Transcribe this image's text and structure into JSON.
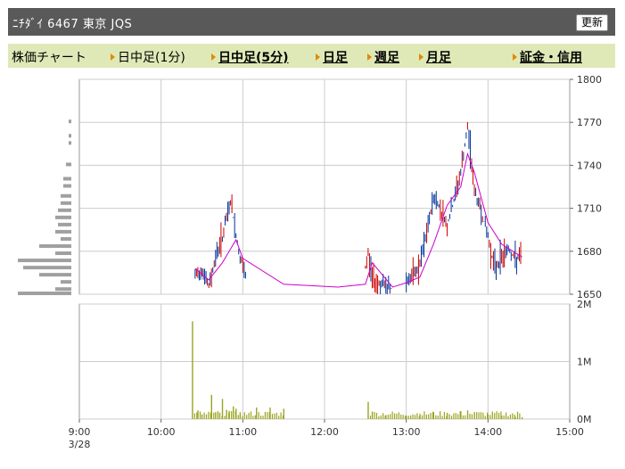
{
  "header": {
    "title": "ﾆﾁﾀﾞｲ  6467  東京 JQS",
    "refresh_label": "更新"
  },
  "tabs": [
    {
      "label": "株価チャート",
      "link": false,
      "marker": false
    },
    {
      "label": "日中足(1分)",
      "link": false,
      "marker": true
    },
    {
      "label": "日中足(5分)",
      "link": true,
      "marker": true
    },
    {
      "label": "日足",
      "link": true,
      "marker": true
    },
    {
      "label": "週足",
      "link": true,
      "marker": true
    },
    {
      "label": "月足",
      "link": true,
      "marker": true
    },
    {
      "label": "証金・信用",
      "link": true,
      "marker": true
    }
  ],
  "colors": {
    "candle_up": "#cc0000",
    "candle_down": "#003399",
    "moving_average": "#cc00cc",
    "volume": "#9aa520",
    "volume_profile": "#a0a0a0",
    "grid": "#cccccc"
  },
  "chart_data": [
    {
      "type": "line",
      "yticks": [
        "1800",
        "1770",
        "1740",
        "1710",
        "1680",
        "1650"
      ],
      "ylim": [
        1650,
        1800
      ],
      "xticks": [
        "9:00",
        "10:00",
        "11:00",
        "12:00",
        "13:00",
        "14:00",
        "15:00"
      ],
      "x_sub_label": "3/28",
      "xlim": [
        "9:00",
        "15:00"
      ],
      "grid": true,
      "series": [
        {
          "x": [
            "10:25",
            "10:35",
            "10:45",
            "10:55",
            "11:00",
            "11:30",
            "12:10",
            "12:30",
            "12:35",
            "12:50",
            "13:00",
            "13:10",
            "13:20",
            "13:30",
            "13:40",
            "13:45",
            "13:50",
            "14:00",
            "14:10",
            "14:20",
            "14:25"
          ],
          "values": [
            1668,
            1660,
            1672,
            1688,
            1675,
            1657,
            1655,
            1657,
            1672,
            1655,
            1658,
            1662,
            1685,
            1712,
            1725,
            1748,
            1735,
            1700,
            1685,
            1679,
            1676
          ]
        }
      ],
      "price_segments": [
        {
          "x": [
            "10:25",
            "10:30",
            "10:35",
            "10:40",
            "10:45",
            "10:48",
            "10:51",
            "10:54",
            "10:57",
            "11:00",
            "11:03"
          ],
          "values": [
            1662,
            1668,
            1655,
            1676,
            1690,
            1702,
            1715,
            1698,
            1680,
            1668,
            1658
          ]
        },
        {
          "x": [
            "12:30",
            "12:32",
            "12:35",
            "12:40",
            "12:45",
            "12:50"
          ],
          "values": [
            1668,
            1678,
            1662,
            1658,
            1655,
            1654
          ]
        },
        {
          "x": [
            "13:00",
            "13:05",
            "13:10",
            "13:15",
            "13:20",
            "13:25",
            "13:30",
            "13:35",
            "13:40",
            "13:45",
            "13:47",
            "13:50",
            "13:55",
            "14:00",
            "14:05",
            "14:10",
            "14:15",
            "14:20",
            "14:25"
          ],
          "values": [
            1660,
            1662,
            1670,
            1692,
            1718,
            1710,
            1698,
            1715,
            1735,
            1765,
            1752,
            1722,
            1708,
            1690,
            1668,
            1676,
            1682,
            1674,
            1676
          ]
        }
      ]
    },
    {
      "type": "bar",
      "yticks": [
        "2M",
        "1M",
        "0M"
      ],
      "ylim": [
        0,
        2000000
      ],
      "x": [
        "10:23",
        "10:27",
        "10:30",
        "10:37",
        "10:40",
        "10:43",
        "10:45",
        "10:48",
        "10:50",
        "10:53",
        "10:55",
        "10:58",
        "11:10",
        "11:20",
        "11:30",
        "12:32",
        "12:35",
        "12:45",
        "13:00",
        "13:10",
        "13:20",
        "13:30",
        "13:40",
        "13:45",
        "13:50",
        "14:00",
        "14:10",
        "14:20",
        "14:25"
      ],
      "values": [
        1700000,
        150000,
        80000,
        420000,
        120000,
        110000,
        350000,
        160000,
        140000,
        220000,
        180000,
        120000,
        200000,
        200000,
        180000,
        300000,
        130000,
        70000,
        60000,
        90000,
        120000,
        110000,
        140000,
        150000,
        120000,
        80000,
        60000,
        40000,
        30000
      ]
    },
    {
      "type": "bar",
      "orientation": "horizontal",
      "categories": [
        1650,
        1653,
        1658,
        1663,
        1668,
        1673,
        1678,
        1683,
        1688,
        1693,
        1698,
        1703,
        1708,
        1713,
        1718,
        1725,
        1730,
        1740,
        1755,
        1760,
        1770
      ],
      "values": [
        100,
        30,
        20,
        60,
        90,
        100,
        30,
        60,
        20,
        30,
        25,
        30,
        25,
        20,
        20,
        15,
        15,
        10,
        5,
        5,
        5
      ]
    }
  ]
}
